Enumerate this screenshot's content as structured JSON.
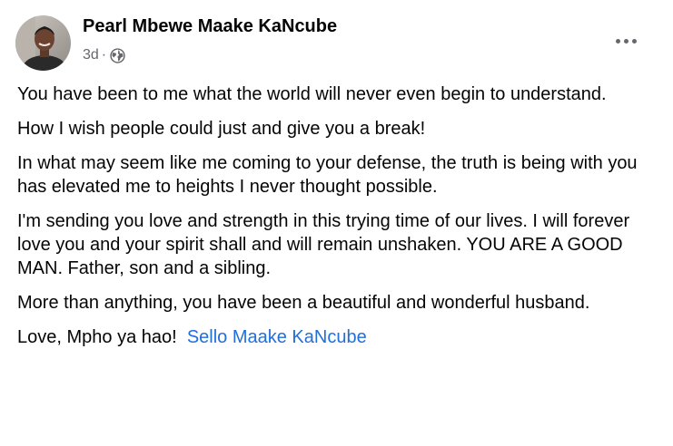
{
  "post": {
    "author": "Pearl Mbewe Maake KaNcube",
    "time": "3d",
    "separator": "·",
    "privacy_icon": "globe-icon",
    "more_icon": "more-horizontal-icon",
    "paragraphs": [
      "You have been to me what the world will never even begin to understand.",
      "How I wish people could just and give you a break!",
      "In what may seem like me coming to your defense, the truth is being with you has elevated me to heights I never thought possible.",
      "I'm sending you love and strength in this trying time of our lives. I will forever love you and your spirit shall and will remain unshaken. YOU ARE A GOOD MAN. Father, son and a sibling.",
      "More than anything, you have been a beautiful and wonderful husband."
    ],
    "signoff": "Love, Mpho ya hao!",
    "tagged_name": "Sello Maake KaNcube"
  },
  "colors": {
    "text": "#050505",
    "secondary": "#65676b",
    "link": "#216fdb"
  }
}
